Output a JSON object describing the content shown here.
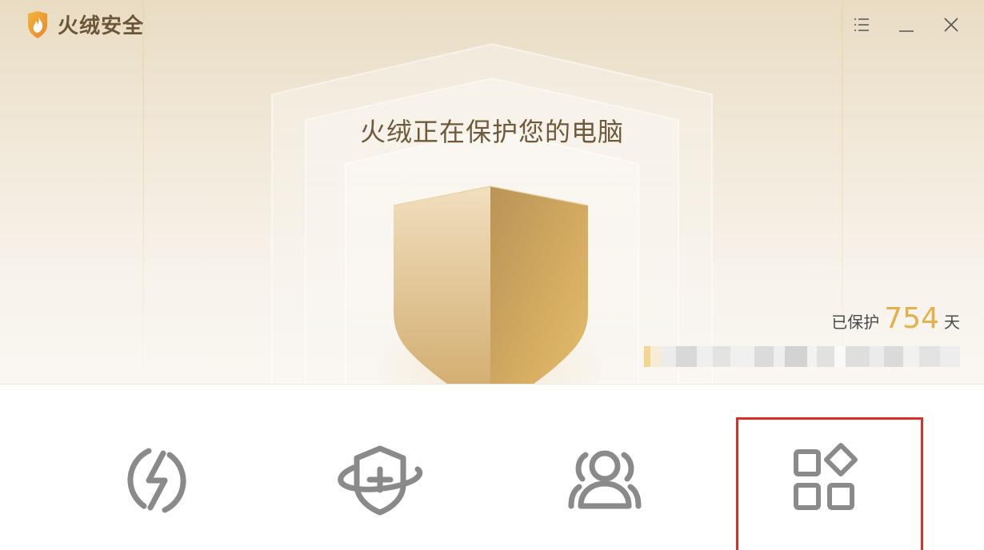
{
  "app": {
    "name": "火绒安全"
  },
  "window_controls": {
    "menu_icon": "menu-icon",
    "minimize_icon": "minimize-icon",
    "close_icon": "close-icon"
  },
  "status": {
    "title": "火绒正在保护您的电脑",
    "protected_prefix": "已保护",
    "protected_days": "754",
    "protected_suffix": "天"
  },
  "features": [
    {
      "icon": "lightning-icon"
    },
    {
      "icon": "shield-plus-icon"
    },
    {
      "icon": "users-icon"
    },
    {
      "icon": "apps-grid-icon"
    }
  ],
  "colors": {
    "accent_gold": "#e3b04b",
    "brand_brown": "#6b5637",
    "icon_gray": "#8a8a8a",
    "highlight_red": "#d9302a"
  }
}
